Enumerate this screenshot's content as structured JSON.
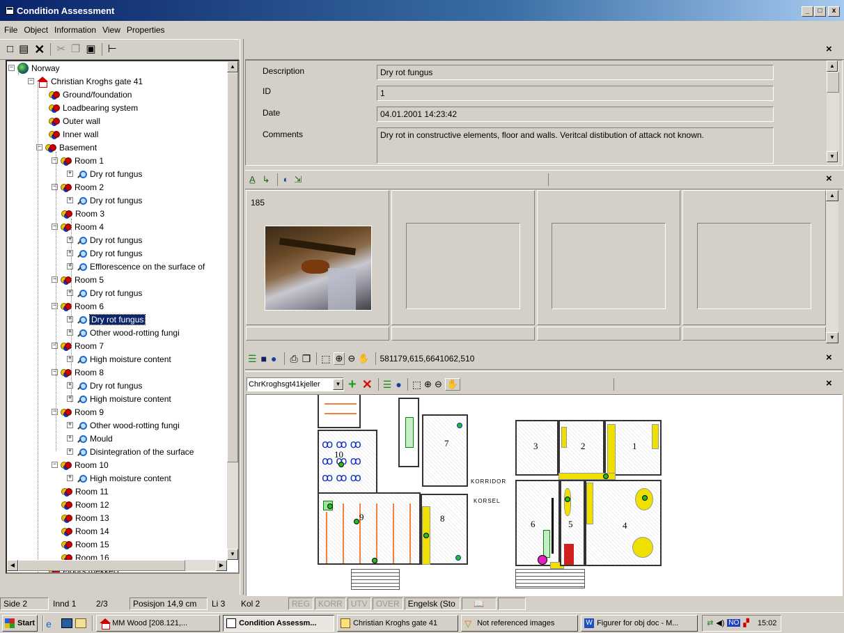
{
  "window": {
    "title": "Condition Assessment",
    "min_glyph": "_",
    "max_glyph": "□",
    "close_glyph": "x"
  },
  "menu": [
    "File",
    "Object",
    "Information",
    "View",
    "Properties"
  ],
  "tree": {
    "root": "Norway",
    "building": "Christian Kroghs gate 41",
    "items": [
      {
        "label": "Ground/foundation"
      },
      {
        "label": "Loadbearing system"
      },
      {
        "label": "Outer wall"
      },
      {
        "label": "Inner wall"
      },
      {
        "label": "Basement"
      },
      {
        "label": "Room 1"
      },
      {
        "label": "Dry rot fungus"
      },
      {
        "label": "Room 2"
      },
      {
        "label": "Dry rot fungus"
      },
      {
        "label": "Room 3"
      },
      {
        "label": "Room 4"
      },
      {
        "label": "Dry rot fungus"
      },
      {
        "label": "Dry rot fungus"
      },
      {
        "label": "Efflorescence on the surface of"
      },
      {
        "label": "Room 5"
      },
      {
        "label": "Dry rot fungus"
      },
      {
        "label": "Room 6"
      },
      {
        "label": "Dry rot fungus"
      },
      {
        "label": "Other wood-rotting fungi"
      },
      {
        "label": "Room 7"
      },
      {
        "label": "High moisture content"
      },
      {
        "label": "Room 8"
      },
      {
        "label": "Dry rot fungus"
      },
      {
        "label": "High moisture content"
      },
      {
        "label": "Room 9"
      },
      {
        "label": "Other wood-rotting fungi"
      },
      {
        "label": "Mould"
      },
      {
        "label": "Disintegration of the surface"
      },
      {
        "label": "Room 10"
      },
      {
        "label": "High moisture content"
      },
      {
        "label": "Room 11"
      },
      {
        "label": "Room 12"
      },
      {
        "label": "Room 13"
      },
      {
        "label": "Room 14"
      },
      {
        "label": "Room 15"
      },
      {
        "label": "Room 16"
      },
      {
        "label": "Floors (dekker)"
      }
    ]
  },
  "details": {
    "description_label": "Description",
    "description_value": "Dry rot fungus",
    "id_label": "ID",
    "id_value": "1",
    "date_label": "Date",
    "date_value": "04.01.2001 14:23:42",
    "comments_label": "Comments",
    "comments_value": "Dry rot in constructive elements, floor and walls. Veritcal distibution of attack not known."
  },
  "images": {
    "first_number": "185"
  },
  "map_toolbar": {
    "coordinates": "581179,615,6641062,510"
  },
  "layer_toolbar": {
    "layer_select": "ChrKroghsgt41kjeller"
  },
  "floorplan": {
    "rooms": [
      "1",
      "2",
      "3",
      "4",
      "5",
      "6",
      "7",
      "8",
      "9",
      "10"
    ],
    "text_corridor": "KORRIDOR",
    "text_korsel": "KORSEL"
  },
  "status": {
    "side": "Side 2",
    "innd": "Innd 1",
    "page": "2/3",
    "posisjon": "Posisjon 14,9 cm",
    "li": "Li 3",
    "kol": "Kol 2",
    "reg": "REG",
    "korr": "KORR",
    "utv": "UTV",
    "over": "OVER",
    "lang": "Engelsk (Sto"
  },
  "taskbar": {
    "start": "Start",
    "tasks": [
      "MM Wood  [208.121,...",
      "Condition Assessm...",
      "Christian Kroghs gate 41",
      "Not referenced images",
      "Figurer for obj doc - M..."
    ],
    "lang_indicator": "NO",
    "clock": "15:02"
  }
}
